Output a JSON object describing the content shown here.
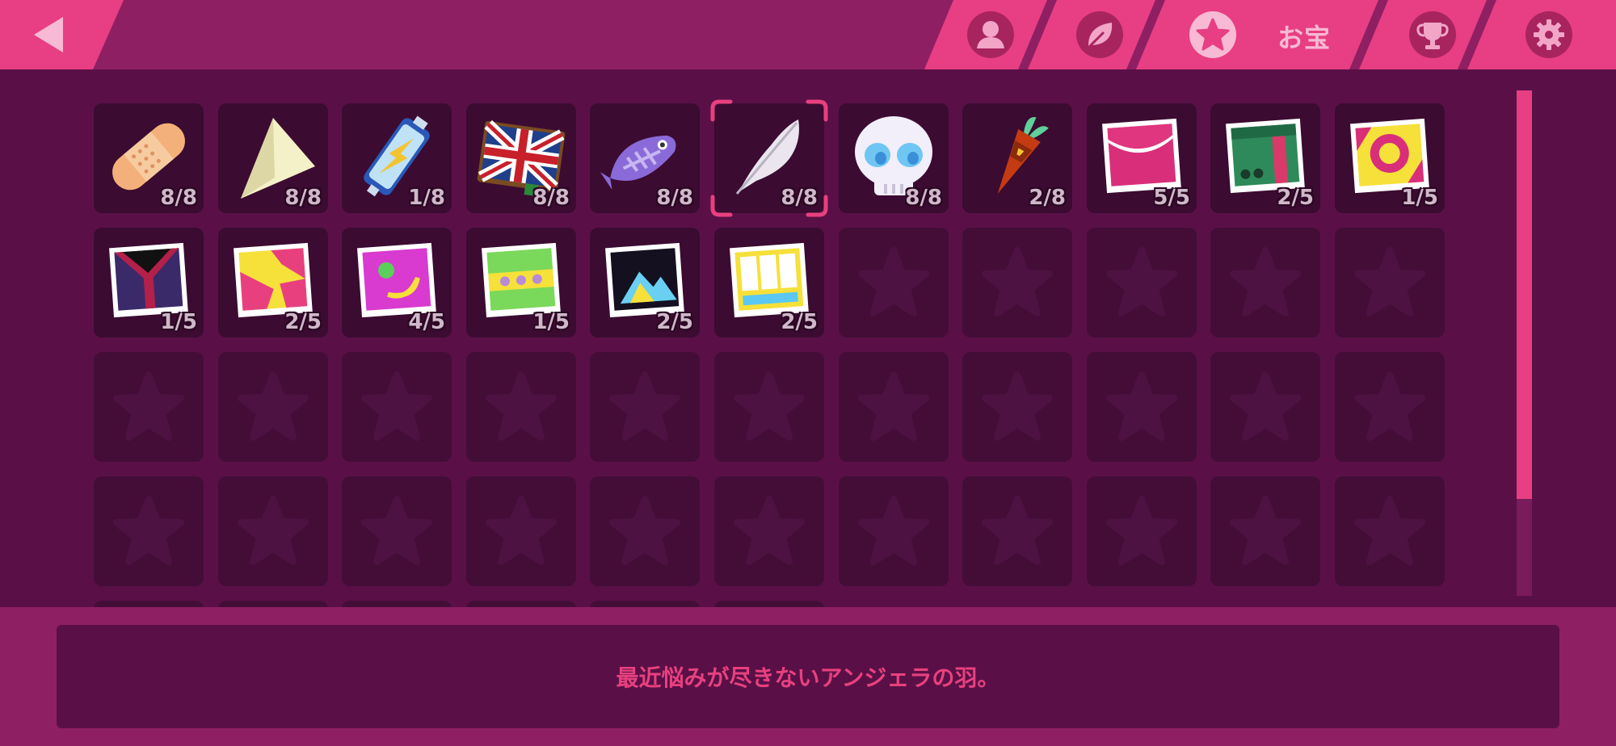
{
  "header": {
    "back_icon": "triangle-left-icon",
    "tabs": [
      {
        "icon": "person-icon",
        "label": ""
      },
      {
        "icon": "leaf-icon",
        "label": ""
      },
      {
        "icon": "star-icon",
        "label": "お宝",
        "active": true
      },
      {
        "icon": "trophy-icon",
        "label": ""
      },
      {
        "icon": "gear-icon",
        "label": ""
      }
    ]
  },
  "items": [
    {
      "name": "bandage",
      "count": "8/8"
    },
    {
      "name": "paper-plane",
      "count": "8/8"
    },
    {
      "name": "battery",
      "count": "1/8"
    },
    {
      "name": "union-jack-book",
      "count": "8/8"
    },
    {
      "name": "fish-bone",
      "count": "8/8"
    },
    {
      "name": "feather",
      "count": "8/8",
      "selected": true
    },
    {
      "name": "skull",
      "count": "8/8"
    },
    {
      "name": "carrot",
      "count": "2/8"
    },
    {
      "name": "photo-pink-circle",
      "count": "5/5"
    },
    {
      "name": "photo-green-door",
      "count": "2/5"
    },
    {
      "name": "photo-yellow-ring",
      "count": "1/5"
    },
    {
      "name": "photo-y-letter",
      "count": "1/5"
    },
    {
      "name": "photo-pink-shapes",
      "count": "2/5"
    },
    {
      "name": "photo-moon",
      "count": "4/5"
    },
    {
      "name": "photo-dots",
      "count": "1/5"
    },
    {
      "name": "photo-mountains",
      "count": "2/5"
    },
    {
      "name": "photo-window",
      "count": "2/5"
    }
  ],
  "description": "最近悩みが尽きないアンジェラの羽。",
  "colors": {
    "accent": "#e83e83",
    "bar": "#8f1f63",
    "panel": "#5a1047",
    "slot": "#3b0b31"
  },
  "scroll_position": 0.0
}
